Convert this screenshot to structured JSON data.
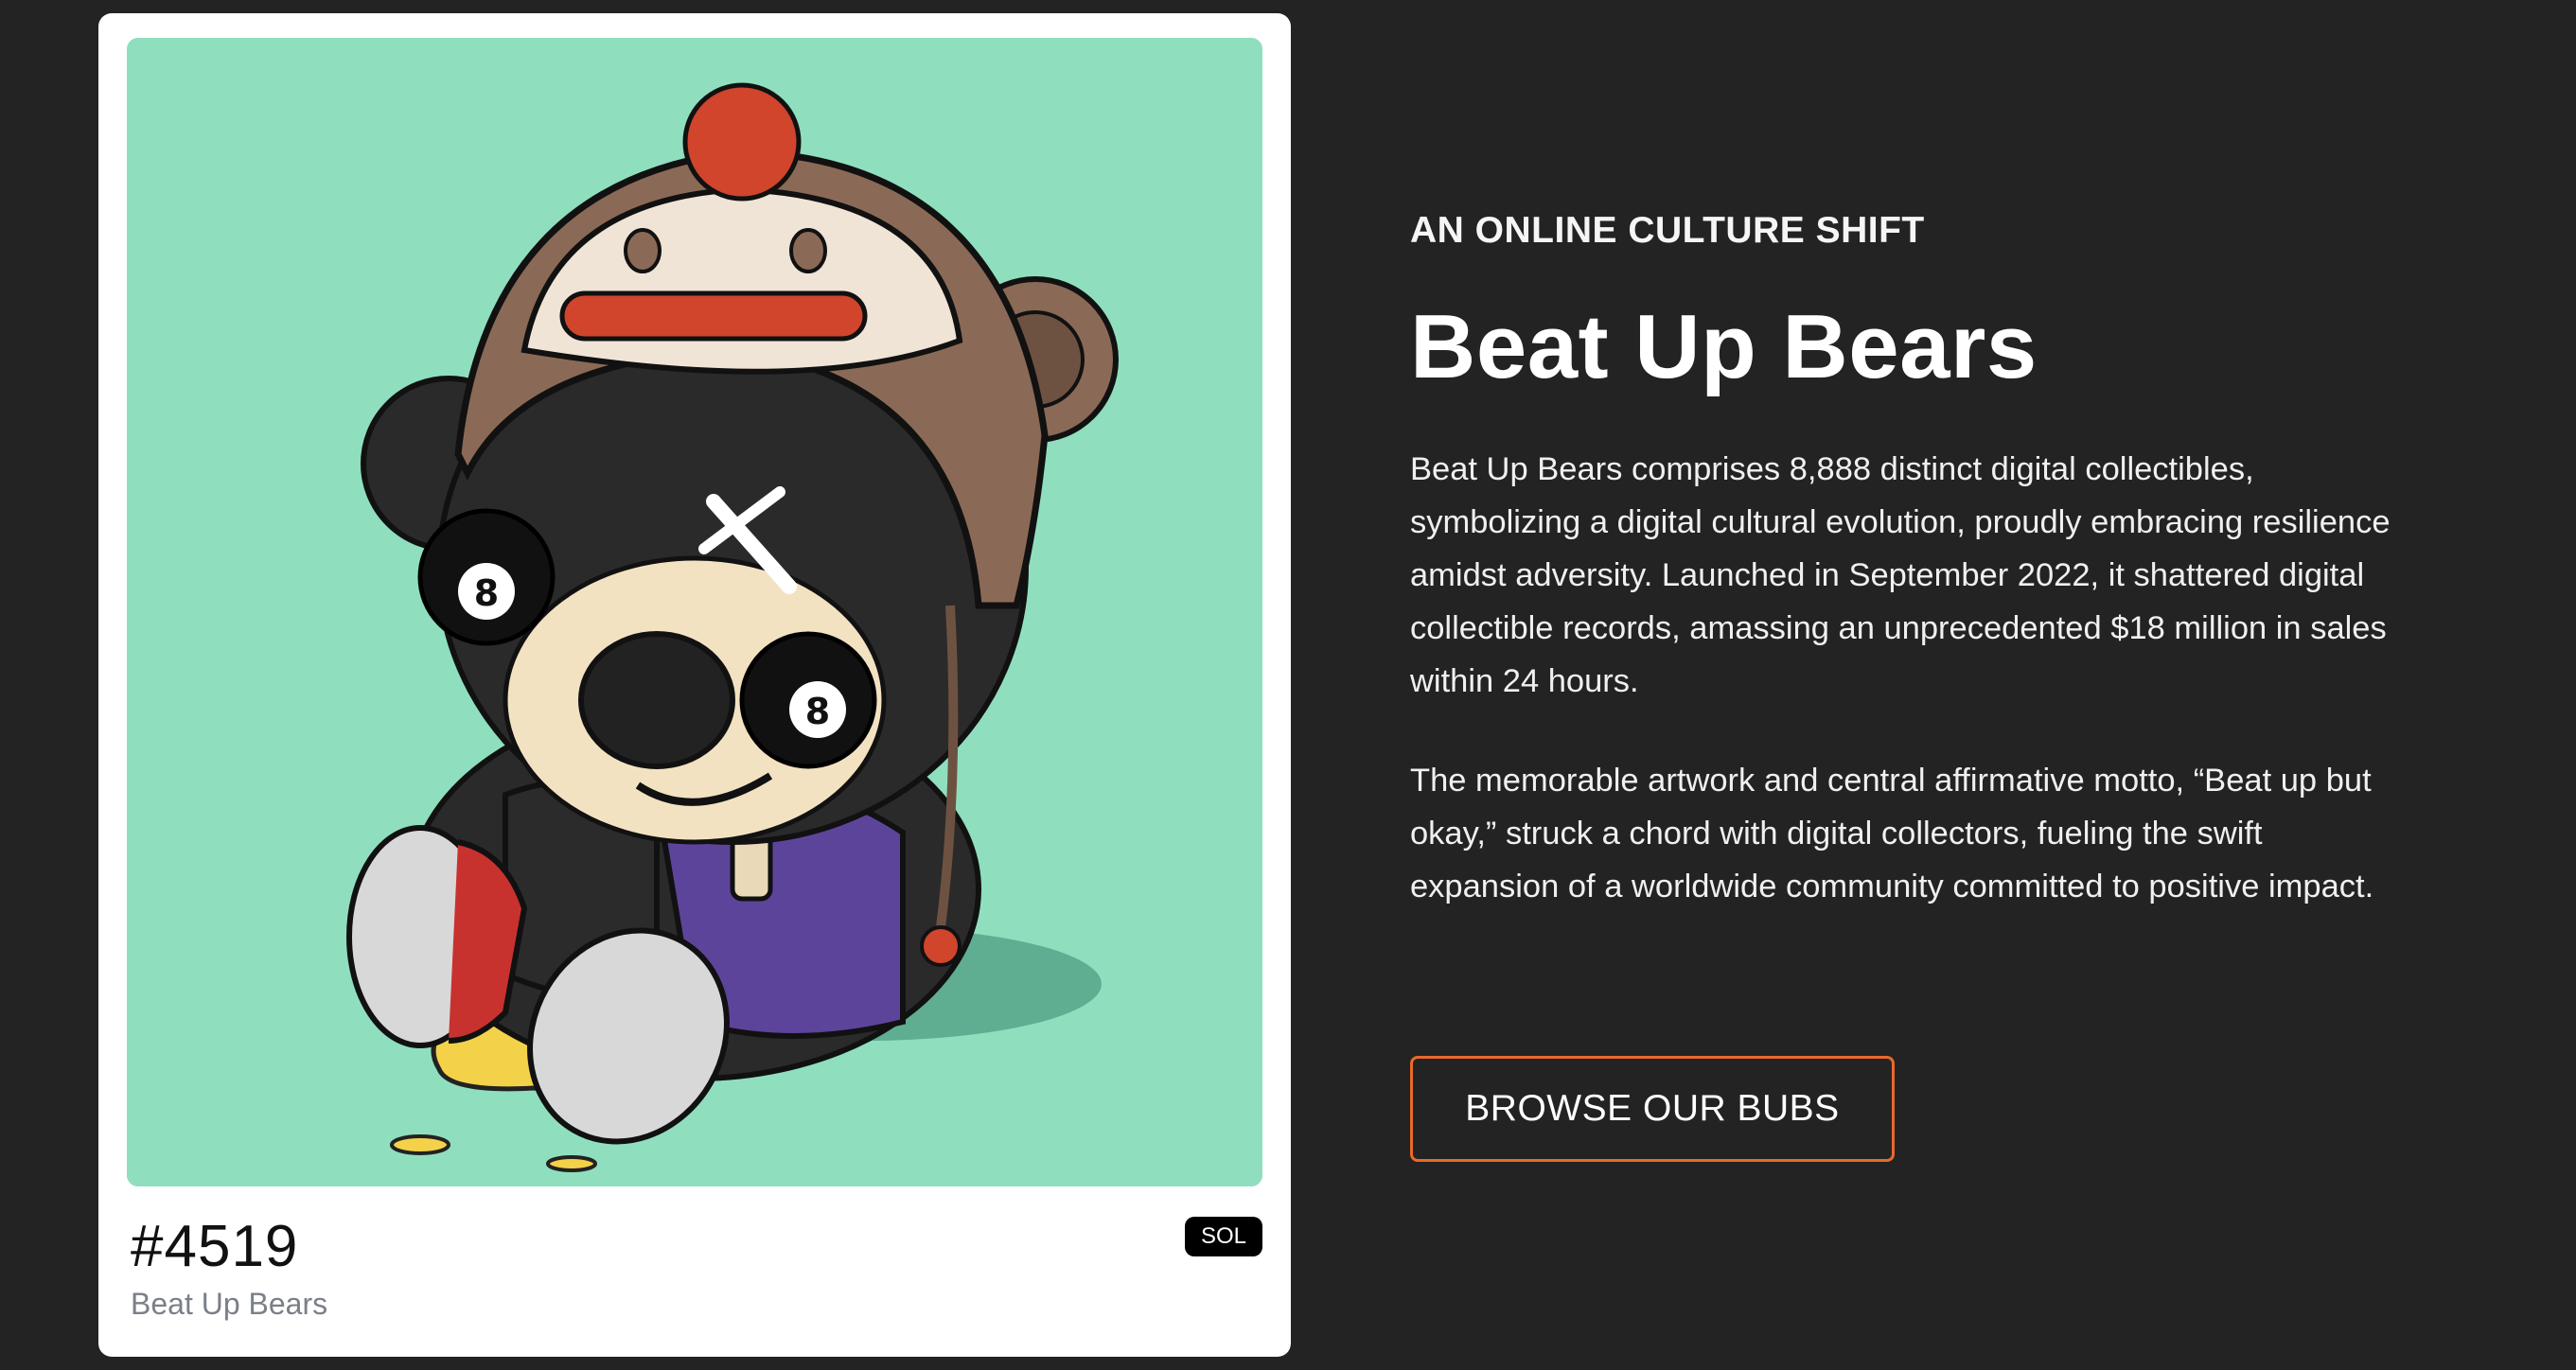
{
  "card": {
    "token_id": "#4519",
    "collection_name": "Beat Up Bears",
    "chain_badge": "SOL",
    "art_background": "#8fdfbf"
  },
  "hero": {
    "eyebrow": "AN ONLINE CULTURE SHIFT",
    "title": "Beat Up Bears",
    "paragraph_1": "Beat Up Bears comprises 8,888 distinct digital collectibles, symbolizing a digital cultural evolution, proudly embracing resilience amidst adversity. Launched in September 2022, it shattered digital collectible records, amassing an unprecedented $18 million in sales within 24 hours.",
    "paragraph_2": "The memorable artwork and central affirmative motto, “Beat up but okay,” struck a chord with digital collectors, fueling the swift expansion of a worldwide community committed to positive impact.",
    "cta_label": "BROWSE OUR BUBS"
  },
  "colors": {
    "page_background": "#232323",
    "accent": "#e8692c",
    "card_background": "#ffffff"
  }
}
